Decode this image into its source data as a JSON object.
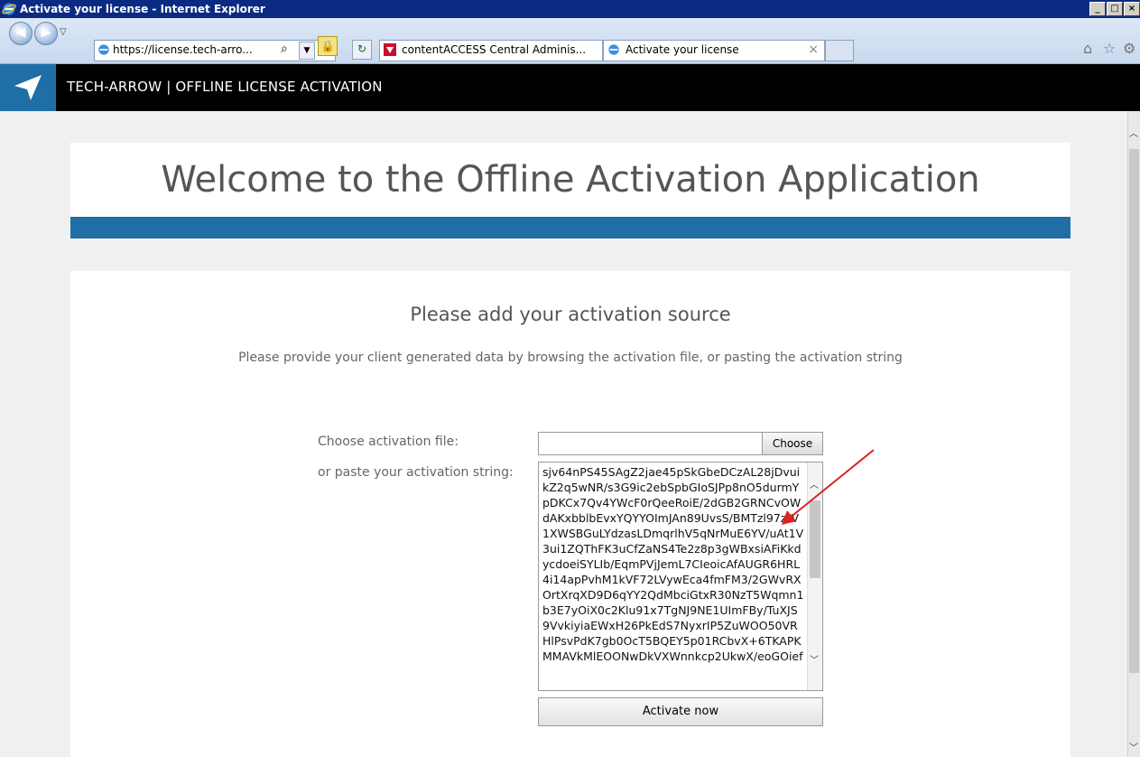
{
  "window": {
    "title": "Activate your license - Internet Explorer"
  },
  "browser": {
    "address": "https://license.tech-arro...",
    "tabs": [
      {
        "label": "contentACCESS Central Adminis..."
      },
      {
        "label": "Activate your license"
      }
    ]
  },
  "app": {
    "header_title": "TECH-ARROW | OFFLINE LICENSE ACTIVATION"
  },
  "welcome": {
    "title": "Welcome to the Offline Activation Application"
  },
  "source": {
    "title": "Please add your activation source",
    "description": "Please provide your client generated data by browsing the activation file, or pasting the activation string",
    "file_label": "Choose activation file:",
    "choose_label": "Choose",
    "paste_label": "or paste your activation string:",
    "activation_string": "sjv64nPS45SAgZ2jae45pSkGbeDCzAL28jDvuikZ2q5wNR/s3G9ic2ebSpbGIoSJPp8nO5durmYpDKCx7Qv4YWcF0rQeeRoiE/2dGB2GRNCvOWdAKxbblbEvxYQYYOImJAn89UvsS/BMTzl97zrV1XWSBGuLYdzasLDmqrlhV5qNrMuE6YV/uAt1V3ui1ZQThFK3uCfZaNS4Te2z8p3gWBxsiAFiKkdycdoeiSYLIb/EqmPVjJemL7CIeoicAfAUGR6HRL4i14apPvhM1kVF72LVywEca4fmFM3/2GWvRXOrtXrqXD9D6qYY2QdMbciGtxR30NzT5Wqmn1b3E7yOiX0c2Klu91x7TgNJ9NE1UImFBy/TuXJS9VvkiyiaEWxH26PkEdS7NyxrIP5ZuWOO50VRHlPsvPdK7gb0OcT5BQEY5p01RCbvX+6TKAPKMMAVkMlEOONwDkVXWnnkcp2UkwX/eoGOief",
    "activate_label": "Activate now"
  }
}
